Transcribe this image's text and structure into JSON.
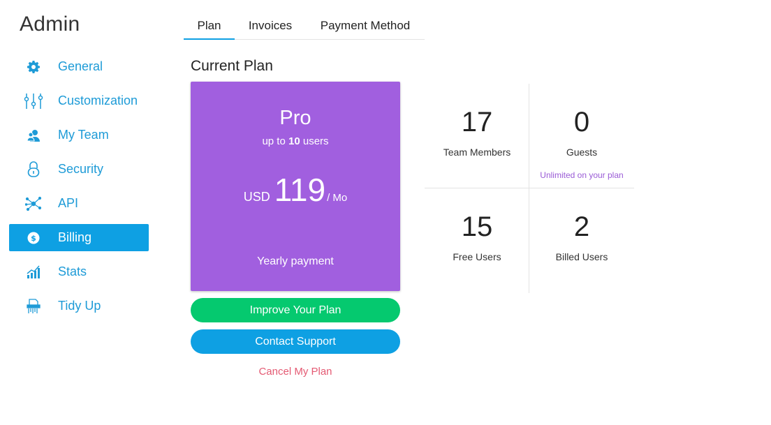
{
  "app": {
    "title": "Admin"
  },
  "sidebar": {
    "items": [
      {
        "label": "General",
        "icon": "gear-icon"
      },
      {
        "label": "Customization",
        "icon": "sliders-icon"
      },
      {
        "label": "My Team",
        "icon": "team-icon"
      },
      {
        "label": "Security",
        "icon": "lock-icon"
      },
      {
        "label": "API",
        "icon": "network-icon"
      },
      {
        "label": "Billing",
        "icon": "dollar-icon",
        "active": true
      },
      {
        "label": "Stats",
        "icon": "stats-icon"
      },
      {
        "label": "Tidy Up",
        "icon": "shredder-icon"
      }
    ]
  },
  "tabs": [
    {
      "label": "Plan",
      "active": true
    },
    {
      "label": "Invoices"
    },
    {
      "label": "Payment Method"
    }
  ],
  "section": {
    "title": "Current Plan"
  },
  "plan": {
    "name": "Pro",
    "users_prefix": "up to",
    "users_count": "10",
    "users_suffix": "users",
    "currency": "USD",
    "amount": "119",
    "period": "/ Mo",
    "billing_cycle": "Yearly payment"
  },
  "actions": {
    "improve": "Improve Your Plan",
    "support": "Contact Support",
    "cancel": "Cancel My Plan"
  },
  "stats": [
    {
      "value": "17",
      "label": "Team Members"
    },
    {
      "value": "0",
      "label": "Guests",
      "note": "Unlimited on your plan"
    },
    {
      "value": "15",
      "label": "Free Users"
    },
    {
      "value": "2",
      "label": "Billed Users"
    }
  ],
  "colors": {
    "accent": "#0ea0e3",
    "plan_card": "#a15fdf",
    "improve_button": "#05c96f",
    "cancel_link": "#e45a73",
    "note": "#9a5bd6"
  }
}
